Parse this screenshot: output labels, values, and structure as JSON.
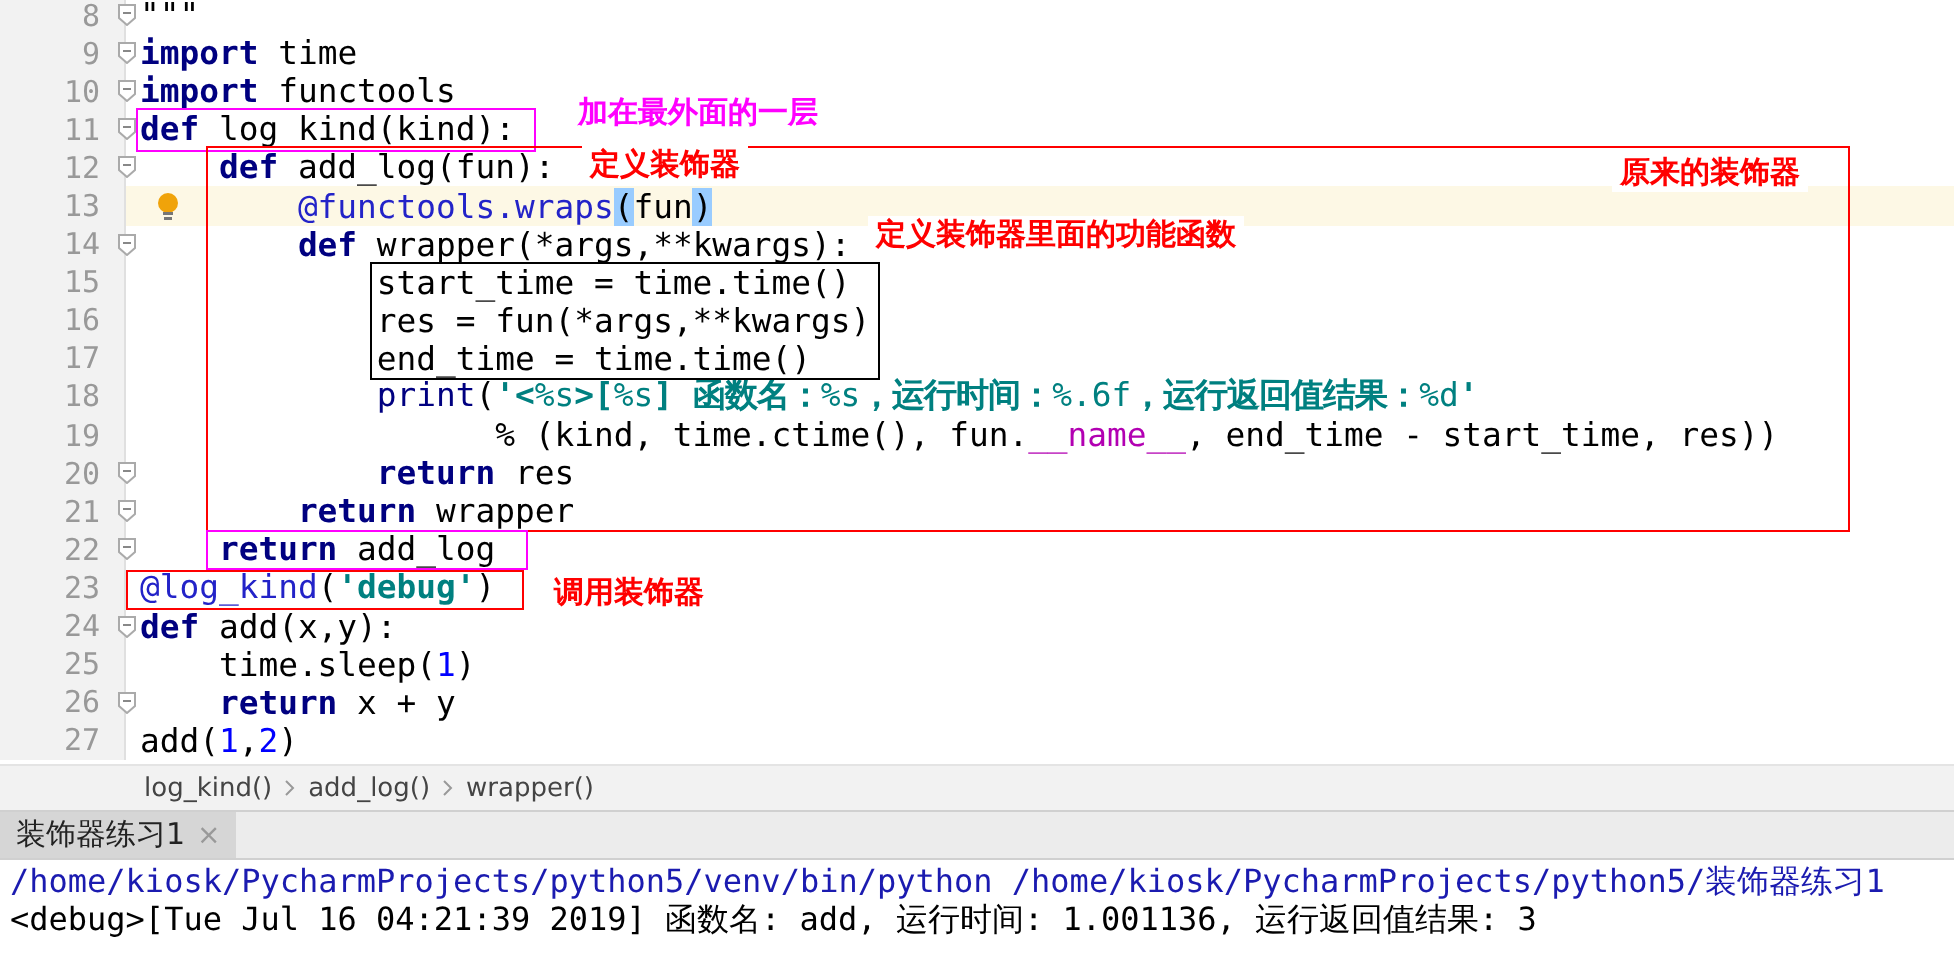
{
  "editor": {
    "lines": [
      {
        "number": "8",
        "fold": true,
        "current": false,
        "bulb": false,
        "tokens": [
          {
            "kind": "plain",
            "text": "\"\"\""
          }
        ]
      },
      {
        "number": "9",
        "fold": true,
        "current": false,
        "bulb": false,
        "tokens": [
          {
            "kind": "kw",
            "text": "import"
          },
          {
            "kind": "plain",
            "text": " time"
          }
        ]
      },
      {
        "number": "10",
        "fold": true,
        "current": false,
        "bulb": false,
        "tokens": [
          {
            "kind": "kw",
            "text": "import"
          },
          {
            "kind": "plain",
            "text": " functools"
          }
        ]
      },
      {
        "number": "11",
        "fold": true,
        "current": false,
        "bulb": false,
        "tokens": [
          {
            "kind": "kw",
            "text": "def"
          },
          {
            "kind": "plain",
            "text": " log_kind(kind):"
          }
        ]
      },
      {
        "number": "12",
        "fold": true,
        "current": false,
        "bulb": false,
        "tokens": [
          {
            "kind": "kw",
            "text": "    def"
          },
          {
            "kind": "plain",
            "text": " add_log(fun):"
          }
        ]
      },
      {
        "number": "13",
        "fold": false,
        "current": true,
        "bulb": true,
        "tokens": [
          {
            "kind": "deco",
            "text": "        @functools.wraps"
          },
          {
            "kind": "match",
            "text": "("
          },
          {
            "kind": "plain",
            "text": "fun"
          },
          {
            "kind": "match",
            "text": ")"
          }
        ]
      },
      {
        "number": "14",
        "fold": true,
        "current": false,
        "bulb": false,
        "tokens": [
          {
            "kind": "kw",
            "text": "        def"
          },
          {
            "kind": "plain",
            "text": " wrapper(*args,**kwargs):"
          }
        ]
      },
      {
        "number": "15",
        "fold": false,
        "current": false,
        "bulb": false,
        "tokens": [
          {
            "kind": "plain",
            "text": "            start_time = time.time()"
          }
        ]
      },
      {
        "number": "16",
        "fold": false,
        "current": false,
        "bulb": false,
        "tokens": [
          {
            "kind": "plain",
            "text": "            res = fun(*args,**kwargs)"
          }
        ]
      },
      {
        "number": "17",
        "fold": false,
        "current": false,
        "bulb": false,
        "tokens": [
          {
            "kind": "plain",
            "text": "            end_time = time.time()"
          }
        ]
      },
      {
        "number": "18",
        "fold": false,
        "current": false,
        "bulb": false,
        "tokens": [
          {
            "kind": "builtin",
            "text": "            print"
          },
          {
            "kind": "plain",
            "text": "("
          },
          {
            "kind": "str",
            "text": "'<"
          },
          {
            "kind": "fmt",
            "text": "%s"
          },
          {
            "kind": "str",
            "text": ">["
          },
          {
            "kind": "fmt",
            "text": "%s"
          },
          {
            "kind": "str",
            "text": "] 函数名："
          },
          {
            "kind": "fmt",
            "text": "%s"
          },
          {
            "kind": "str",
            "text": "，运行时间："
          },
          {
            "kind": "fmt",
            "text": "%.6f"
          },
          {
            "kind": "str",
            "text": "，运行返回值结果："
          },
          {
            "kind": "fmt",
            "text": "%d"
          },
          {
            "kind": "str",
            "text": "'"
          }
        ]
      },
      {
        "number": "19",
        "fold": false,
        "current": false,
        "bulb": false,
        "tokens": [
          {
            "kind": "plain",
            "text": "                  % (kind, time.ctime(), fun."
          },
          {
            "kind": "magic",
            "text": "__name__"
          },
          {
            "kind": "plain",
            "text": ", end_time - start_time, res))"
          }
        ]
      },
      {
        "number": "20",
        "fold": true,
        "current": false,
        "bulb": false,
        "tokens": [
          {
            "kind": "kw",
            "text": "            return"
          },
          {
            "kind": "plain",
            "text": " res"
          }
        ]
      },
      {
        "number": "21",
        "fold": true,
        "current": false,
        "bulb": false,
        "tokens": [
          {
            "kind": "kw",
            "text": "        return"
          },
          {
            "kind": "plain",
            "text": " wrapper"
          }
        ]
      },
      {
        "number": "22",
        "fold": true,
        "current": false,
        "bulb": false,
        "tokens": [
          {
            "kind": "kw",
            "text": "    return"
          },
          {
            "kind": "plain",
            "text": " add_log"
          }
        ]
      },
      {
        "number": "23",
        "fold": false,
        "current": false,
        "bulb": false,
        "tokens": [
          {
            "kind": "deco",
            "text": "@log_kind"
          },
          {
            "kind": "plain",
            "text": "("
          },
          {
            "kind": "str",
            "text": "'debug'"
          },
          {
            "kind": "plain",
            "text": ")"
          }
        ]
      },
      {
        "number": "24",
        "fold": true,
        "current": false,
        "bulb": false,
        "tokens": [
          {
            "kind": "kw",
            "text": "def"
          },
          {
            "kind": "plain",
            "text": " add(x,y):"
          }
        ]
      },
      {
        "number": "25",
        "fold": false,
        "current": false,
        "bulb": false,
        "tokens": [
          {
            "kind": "plain",
            "text": "    time.sleep("
          },
          {
            "kind": "num",
            "text": "1"
          },
          {
            "kind": "plain",
            "text": ")"
          }
        ]
      },
      {
        "number": "26",
        "fold": true,
        "current": false,
        "bulb": false,
        "tokens": [
          {
            "kind": "kw",
            "text": "    return"
          },
          {
            "kind": "plain",
            "text": " x + y"
          }
        ]
      },
      {
        "number": "27",
        "fold": false,
        "current": false,
        "bulb": false,
        "tokens": [
          {
            "kind": "plain",
            "text": "add("
          },
          {
            "kind": "num",
            "text": "1"
          },
          {
            "kind": "plain",
            "text": ","
          },
          {
            "kind": "num",
            "text": "2"
          },
          {
            "kind": "plain",
            "text": ")"
          }
        ]
      }
    ]
  },
  "annotations": [
    {
      "kind": "box",
      "color": "#ff00ff"
    },
    {
      "kind": "label",
      "text": "加在最外面的一层",
      "color": "#ff00ff"
    },
    {
      "kind": "box",
      "color": "#ff0000"
    },
    {
      "kind": "label",
      "text": "定义装饰器",
      "color": "#ff0000"
    },
    {
      "kind": "label",
      "text": "原来的装饰器",
      "color": "#ff0000"
    },
    {
      "kind": "label",
      "text": "定义装饰器里面的功能函数",
      "color": "#ff0000"
    },
    {
      "kind": "box",
      "color": "#000000"
    },
    {
      "kind": "box",
      "color": "#ff00ff"
    },
    {
      "kind": "box",
      "color": "#ff0000"
    },
    {
      "kind": "label",
      "text": "调用装饰器",
      "color": "#ff0000"
    }
  ],
  "breadcrumbs": [
    "log_kind()",
    "add_log()",
    "wrapper()"
  ],
  "run_tab": {
    "label": "装饰器练习1",
    "close": "×"
  },
  "console": [
    {
      "kind": "command",
      "text": "/home/kiosk/PycharmProjects/python5/venv/bin/python /home/kiosk/PycharmProjects/python5/装饰器练习1"
    },
    {
      "kind": "output",
      "text": "<debug>[Tue Jul 16 04:21:39 2019] 函数名: add, 运行时间: 1.001136, 运行返回值结果: 3"
    }
  ]
}
